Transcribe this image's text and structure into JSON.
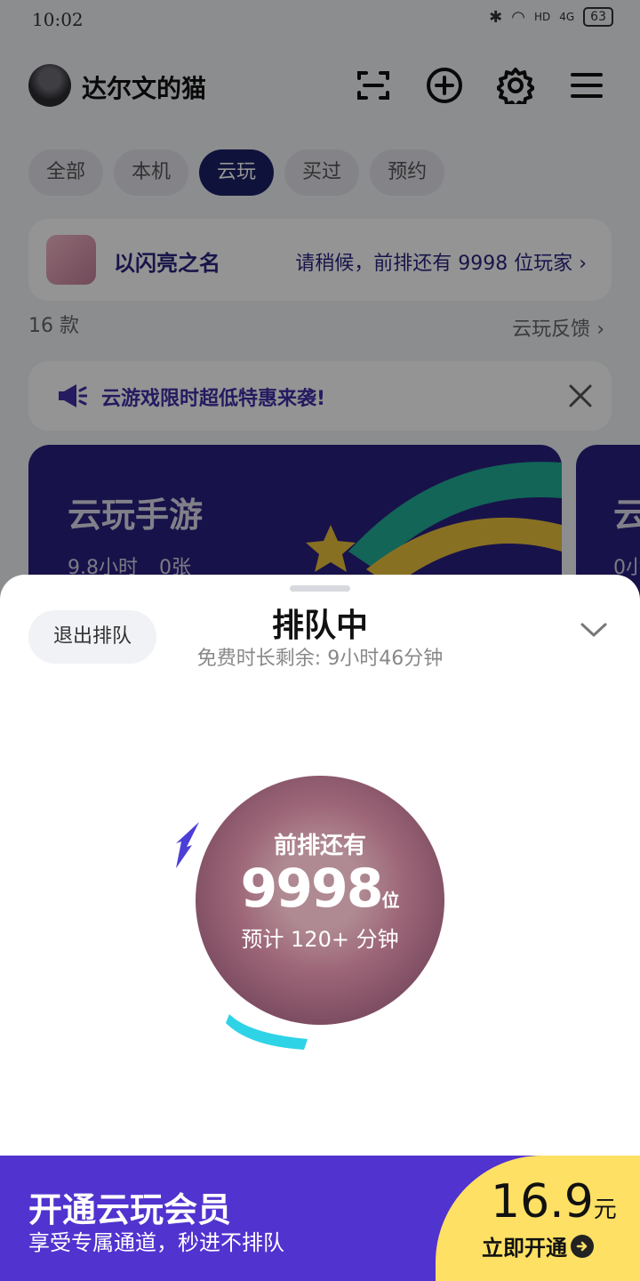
{
  "status": {
    "time": "10:02",
    "network": "4G",
    "hd": "HD",
    "battery": "63"
  },
  "header": {
    "username": "达尔文的猫"
  },
  "tabs": [
    {
      "label": "全部"
    },
    {
      "label": "本机"
    },
    {
      "label": "云玩",
      "active": true
    },
    {
      "label": "买过"
    },
    {
      "label": "预约"
    }
  ],
  "queue_card": {
    "game_name": "以闪亮之名",
    "message": "请稍候，前排还有 9998 位玩家"
  },
  "list": {
    "count": "16 款",
    "feedback": "云玩反馈"
  },
  "promo": {
    "text": "云游戏限时超低特惠来袭!"
  },
  "banner": {
    "title": "云玩手游",
    "hours": "9.8小时",
    "cards": "0张",
    "next_title": "云",
    "next_hours": "0小"
  },
  "sheet": {
    "exit_label": "退出排队",
    "title": "排队中",
    "subtitle": "免费时长剩余: 9小时46分钟",
    "ahead_label": "前排还有",
    "ahead_count": "9998",
    "ahead_unit": "位",
    "eta": "预计 120+ 分钟"
  },
  "vip": {
    "title": "开通云玩会员",
    "subtitle": "享受专属通道，秒进不排队",
    "price": "16.9",
    "currency": "元",
    "cta": "立即开通"
  },
  "colors": {
    "accent": "#5133cf",
    "navy": "#1b2266",
    "cta_bg": "#fde064",
    "link": "#2a2580"
  }
}
